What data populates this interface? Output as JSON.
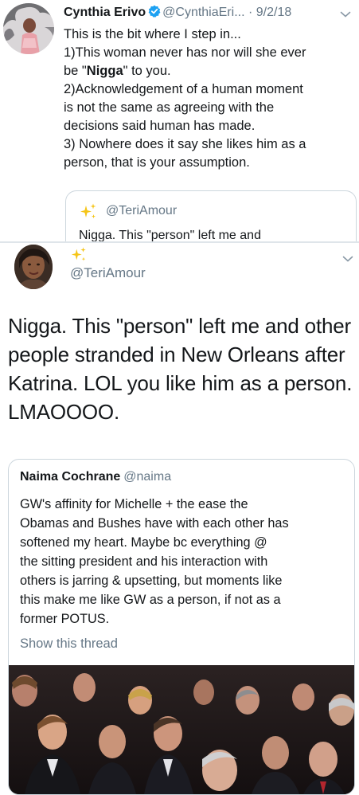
{
  "top_tweet": {
    "author_name": "Cynthia Erivo",
    "verified": true,
    "handle": "@CynthiaEri...",
    "separator": "·",
    "date": "9/2/18",
    "lines": {
      "l1": "This is the bit where I step in...",
      "l2_pre": "1)This woman never has nor will she ever",
      "l3_pre": "be \"",
      "l3_bold": "Nigga",
      "l3_post": "\" to you.",
      "l4": "2)Acknowledgement of a human moment",
      "l5": "is not the same as agreeing with the",
      "l6": "decisions said human has made.",
      "l7": "3) Nowhere does it say she likes him as a",
      "l8": "person, that is your assumption."
    },
    "quoted": {
      "handle": "@TeriAmour",
      "text_preview": "Nigga. This \"person\" left me and"
    }
  },
  "second_tweet": {
    "handle": "@TeriAmour",
    "body_lines": [
      "Nigga. This \"person\" left me and other",
      "people stranded in New Orleans after",
      "Katrina. LOL you like him as a person.",
      "LMAOOOO."
    ],
    "quoted": {
      "author_name": "Naima Cochrane",
      "handle": "@naima",
      "body_lines": [
        "GW's affinity for Michelle + the ease the",
        "Obamas and Bushes have with each other has",
        "softened my heart. Maybe bc everything @",
        "the sitting president and his interaction with",
        "others is jarring & upsetting, but moments like",
        "this make me like GW as a person, if not as a",
        "former POTUS."
      ],
      "show_thread_label": "Show this thread"
    }
  },
  "icons": {
    "verified": "verified-badge-icon",
    "caret": "chevron-down-icon",
    "sparkles": "sparkles-icon"
  },
  "colors": {
    "text": "#14171a",
    "secondary": "#657786",
    "verified_blue": "#1da1f2",
    "border": "#ccd6dd",
    "sparkle": "#f5c518"
  }
}
